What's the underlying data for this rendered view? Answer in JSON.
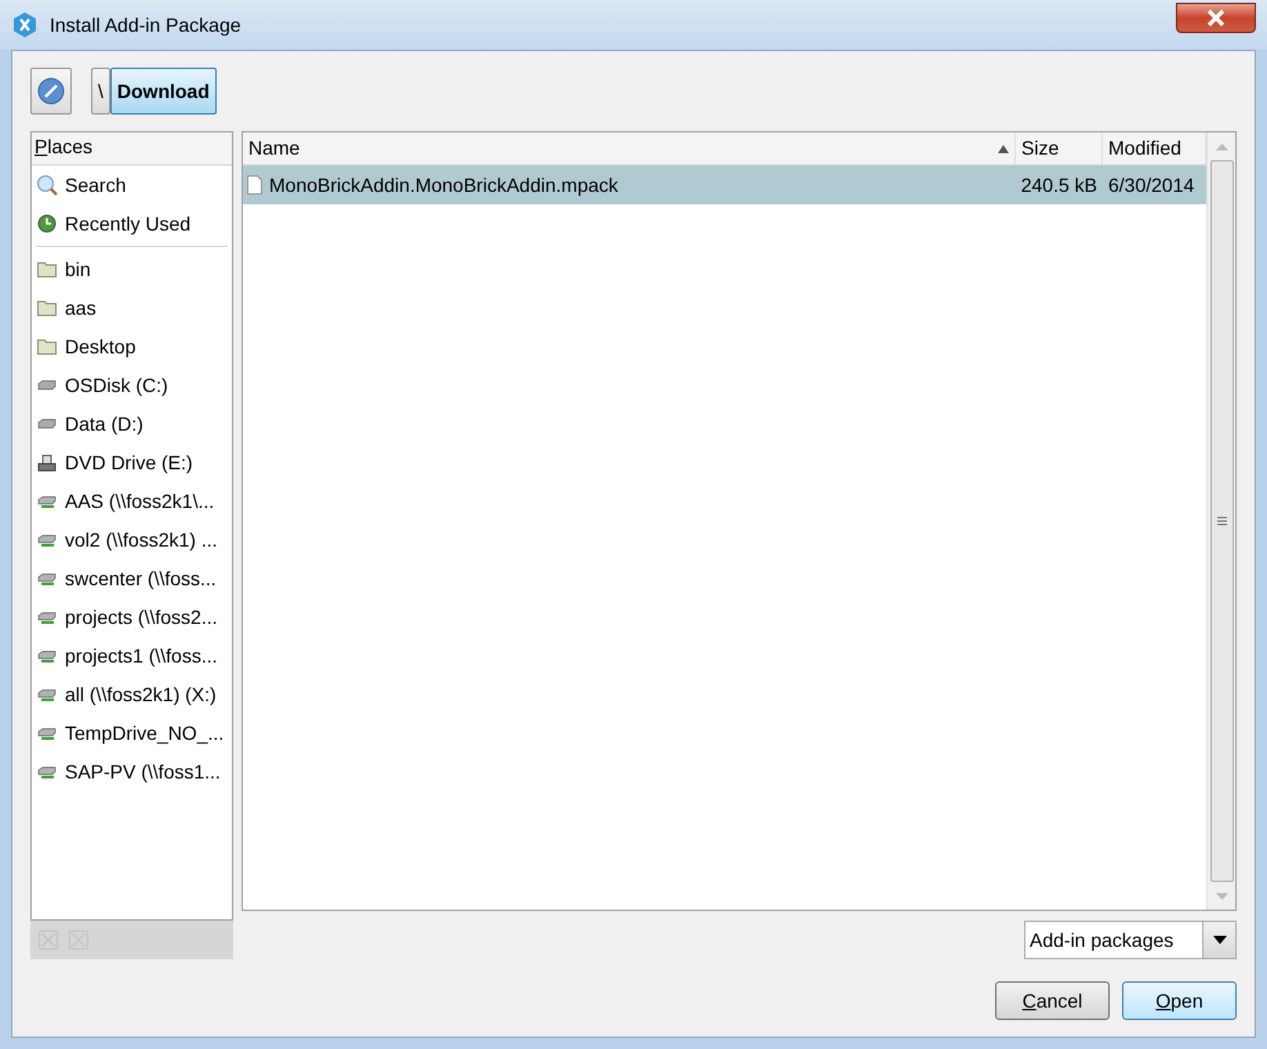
{
  "window": {
    "title": "Install Add-in Package"
  },
  "path_bar": {
    "segments": [
      {
        "label": "\\",
        "selected": false
      },
      {
        "label": "Download",
        "selected": true
      }
    ]
  },
  "places": {
    "header": "Places",
    "system": [
      {
        "kind": "search",
        "label": "Search"
      },
      {
        "kind": "recent",
        "label": "Recently Used"
      }
    ],
    "locations": [
      {
        "kind": "folder",
        "label": "bin"
      },
      {
        "kind": "folder",
        "label": "aas"
      },
      {
        "kind": "folder",
        "label": "Desktop"
      },
      {
        "kind": "disk",
        "label": "OSDisk (C:)"
      },
      {
        "kind": "disk",
        "label": "Data (D:)"
      },
      {
        "kind": "dvd",
        "label": "DVD Drive (E:)"
      },
      {
        "kind": "network",
        "label": "AAS (\\\\foss2k1\\..."
      },
      {
        "kind": "network",
        "label": "vol2 (\\\\foss2k1) ..."
      },
      {
        "kind": "network",
        "label": "swcenter (\\\\foss..."
      },
      {
        "kind": "network",
        "label": "projects (\\\\foss2..."
      },
      {
        "kind": "network",
        "label": "projects1 (\\\\foss..."
      },
      {
        "kind": "network",
        "label": "all (\\\\foss2k1) (X:)"
      },
      {
        "kind": "network",
        "label": "TempDrive_NO_..."
      },
      {
        "kind": "network",
        "label": "SAP-PV (\\\\foss1..."
      }
    ]
  },
  "files": {
    "columns": [
      {
        "label": "Name",
        "sorted": true
      },
      {
        "label": "Size",
        "sorted": false
      },
      {
        "label": "Modified",
        "sorted": false
      }
    ],
    "rows": [
      {
        "name": "MonoBrickAddin.MonoBrickAddin.mpack",
        "size": "240.5 kB",
        "modified": "6/30/2014",
        "selected": true
      }
    ]
  },
  "filter": {
    "value": "Add-in packages"
  },
  "buttons": [
    {
      "label": "Cancel",
      "default": false
    },
    {
      "label": "Open",
      "default": true
    }
  ]
}
